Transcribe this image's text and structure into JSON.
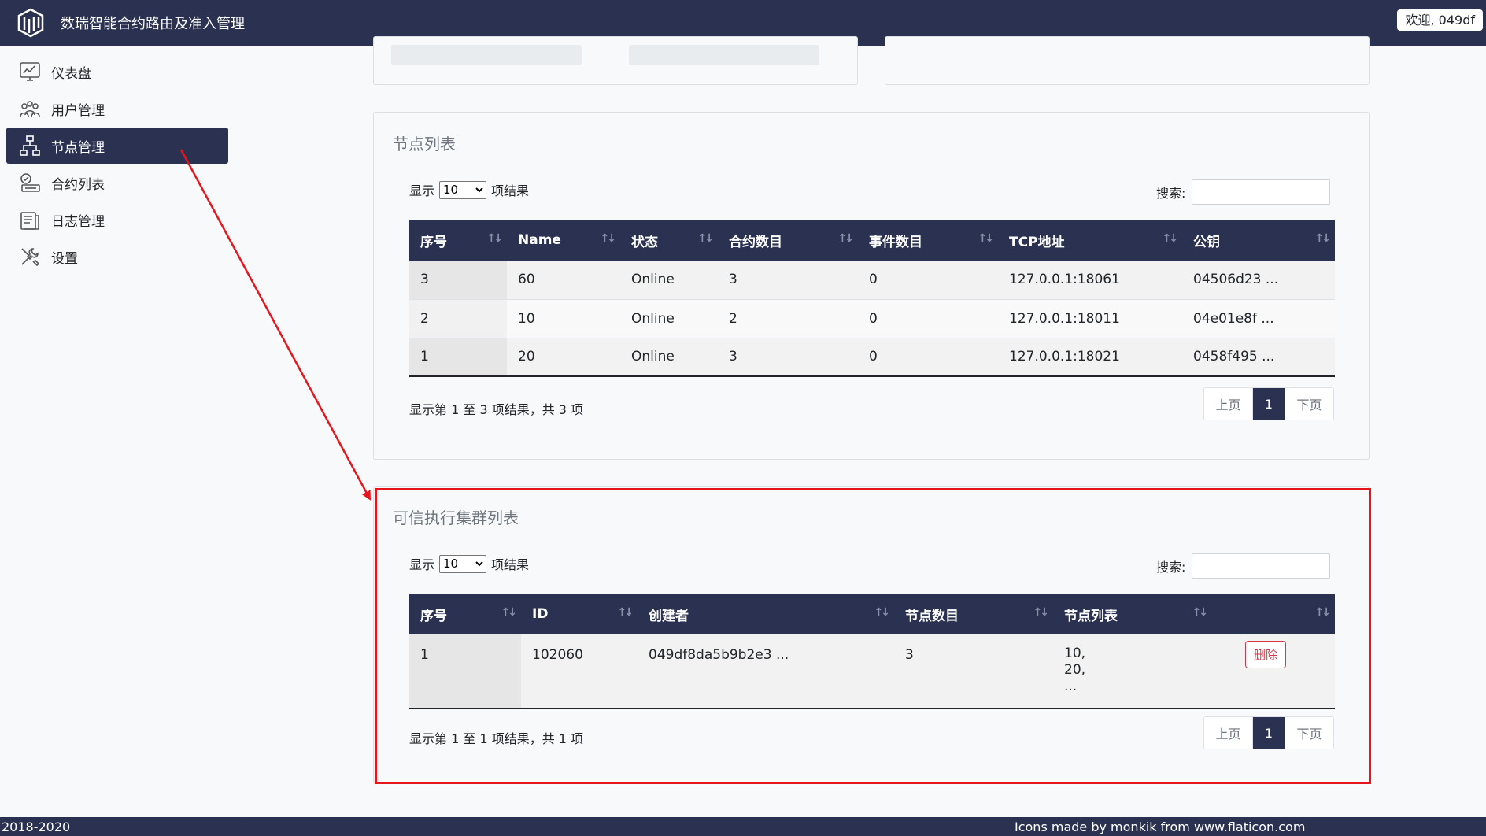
{
  "header": {
    "app_title": "数瑞智能合约路由及准入管理",
    "welcome": "欢迎, 049df"
  },
  "sidebar": {
    "items": [
      {
        "label": "仪表盘",
        "icon": "dashboard-icon"
      },
      {
        "label": "用户管理",
        "icon": "users-icon"
      },
      {
        "label": "节点管理",
        "icon": "network-icon"
      },
      {
        "label": "合约列表",
        "icon": "contract-icon"
      },
      {
        "label": "日志管理",
        "icon": "log-icon"
      },
      {
        "label": "设置",
        "icon": "settings-icon"
      }
    ],
    "active_index": 2
  },
  "nodes": {
    "title": "节点列表",
    "show_prefix": "显示",
    "show_value": "10",
    "show_suffix": "项结果",
    "search_label": "搜索:",
    "columns": [
      "序号",
      "Name",
      "状态",
      "合约数目",
      "事件数目",
      "TCP地址",
      "公钥"
    ],
    "rows": [
      [
        "3",
        "60",
        "Online",
        "3",
        "0",
        "127.0.0.1:18061",
        "04506d23 ..."
      ],
      [
        "2",
        "10",
        "Online",
        "2",
        "0",
        "127.0.0.1:18011",
        "04e01e8f ..."
      ],
      [
        "1",
        "20",
        "Online",
        "3",
        "0",
        "127.0.0.1:18021",
        "0458f495 ..."
      ]
    ],
    "info": "显示第 1 至 3 项结果，共 3 项",
    "pager": {
      "prev": "上页",
      "current": "1",
      "next": "下页"
    }
  },
  "clusters": {
    "title": "可信执行集群列表",
    "show_prefix": "显示",
    "show_value": "10",
    "show_suffix": "项结果",
    "search_label": "搜索:",
    "columns": [
      "序号",
      "ID",
      "创建者",
      "节点数目",
      "节点列表",
      ""
    ],
    "rows": [
      {
        "index": "1",
        "id": "102060",
        "creator": "049df8da5b9b2e3 ...",
        "node_count": "3",
        "node_list": [
          "10,",
          "20,",
          "..."
        ],
        "delete_label": "删除"
      }
    ],
    "info": "显示第 1 至 1 项结果，共 1 项",
    "pager": {
      "prev": "上页",
      "current": "1",
      "next": "下页"
    }
  },
  "footer": {
    "left": "2018-2020",
    "right": "Icons made by monkik from www.flaticon.com"
  },
  "colors": {
    "navy": "#2b3150",
    "annotation_red": "#e8141b",
    "danger": "#dc3545"
  }
}
